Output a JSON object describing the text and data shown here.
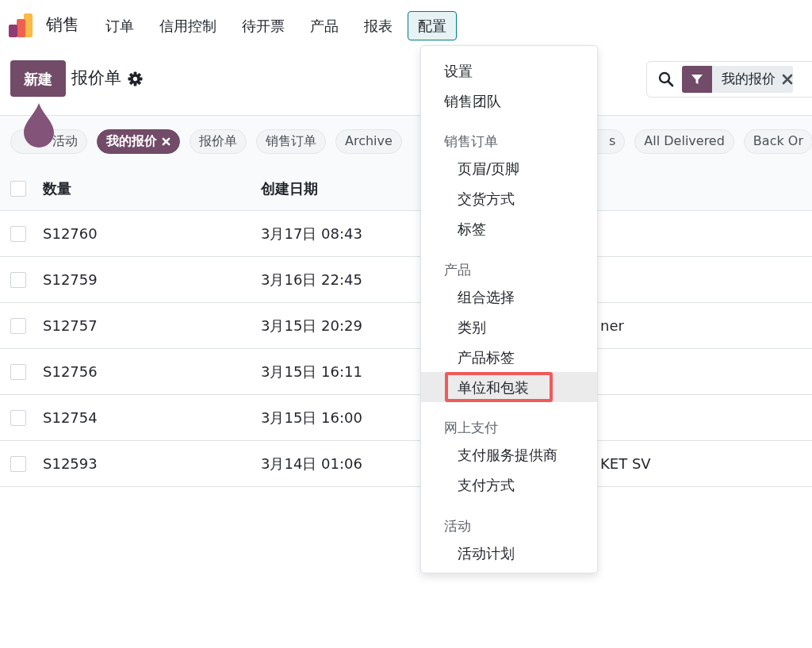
{
  "app": {
    "name": "销售"
  },
  "menu": [
    {
      "label": "订单",
      "selected": false
    },
    {
      "label": "信用控制",
      "selected": false
    },
    {
      "label": "待开票",
      "selected": false
    },
    {
      "label": "产品",
      "selected": false
    },
    {
      "label": "报表",
      "selected": false
    },
    {
      "label": "配置",
      "selected": true
    }
  ],
  "control_panel": {
    "new_button": "新建",
    "title": "报价单"
  },
  "search": {
    "facets": [
      {
        "label": "我的报价"
      }
    ]
  },
  "filters": [
    {
      "label": "活动",
      "selected": false,
      "covered_left": true
    },
    {
      "label": "我的报价",
      "selected": true
    },
    {
      "label": "报价单",
      "selected": false
    },
    {
      "label": "销售订单",
      "selected": false
    },
    {
      "label": "Archive",
      "selected": false
    },
    {
      "label": "s",
      "selected": false,
      "covered_left": true
    },
    {
      "label": "All Delivered",
      "selected": false
    },
    {
      "label": "Back Or",
      "selected": false
    }
  ],
  "table": {
    "columns": [
      "数量",
      "创建日期"
    ],
    "all_checked": false,
    "rows": [
      {
        "checked": false,
        "number": "S12760",
        "date": "3月17日 08:43"
      },
      {
        "checked": false,
        "number": "S12759",
        "date": "3月16日 22:45"
      },
      {
        "checked": false,
        "number": "S12757",
        "date": "3月15日 20:29",
        "column_3": "ner"
      },
      {
        "checked": false,
        "number": "S12756",
        "date": "3月15日 16:11"
      },
      {
        "checked": false,
        "number": "S12754",
        "date": "3月15日 16:00"
      },
      {
        "checked": false,
        "number": "S12593",
        "date": "3月14日 01:06",
        "column_3": "KET SV"
      }
    ]
  },
  "dropdown": {
    "sections": [
      {
        "items": [
          {
            "label": "设置",
            "highlighted": false
          },
          {
            "label": "销售团队",
            "highlighted": false
          }
        ]
      },
      {
        "header": "销售订单",
        "items": [
          {
            "label": "页眉/页脚",
            "highlighted": false
          },
          {
            "label": "交货方式",
            "highlighted": false
          },
          {
            "label": "标签",
            "highlighted": false
          }
        ]
      },
      {
        "header": "产品",
        "items": [
          {
            "label": "组合选择",
            "highlighted": false
          },
          {
            "label": "类别",
            "highlighted": false
          },
          {
            "label": "产品标签",
            "highlighted": false
          },
          {
            "label": "单位和包装",
            "highlighted": true
          }
        ]
      },
      {
        "header": "网上支付",
        "items": [
          {
            "label": "支付服务提供商",
            "highlighted": false
          },
          {
            "label": "支付方式",
            "highlighted": false
          }
        ]
      },
      {
        "header": "活动",
        "items": [
          {
            "label": "活动计划",
            "highlighted": false
          }
        ]
      }
    ]
  }
}
